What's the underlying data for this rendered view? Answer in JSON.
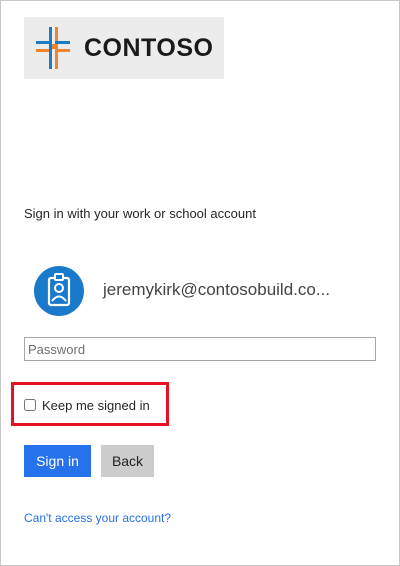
{
  "logo": {
    "text": "CONTOSO",
    "icon": "contoso-logo-mark"
  },
  "heading": "Sign in with your work or school account",
  "account": {
    "avatar_icon": "person-badge-icon",
    "email": "jeremykirk@contosobuild.co..."
  },
  "password": {
    "placeholder": "Password",
    "value": ""
  },
  "keep_signed_in": {
    "label": "Keep me signed in",
    "checked": false
  },
  "buttons": {
    "sign_in": "Sign in",
    "back": "Back"
  },
  "help_link": "Can't access your account?",
  "colors": {
    "accent": "#2672ec",
    "highlight": "#e81123",
    "logo_orange": "#f0842c",
    "logo_blue": "#1f7bc1",
    "avatar_blue": "#1979ca"
  }
}
